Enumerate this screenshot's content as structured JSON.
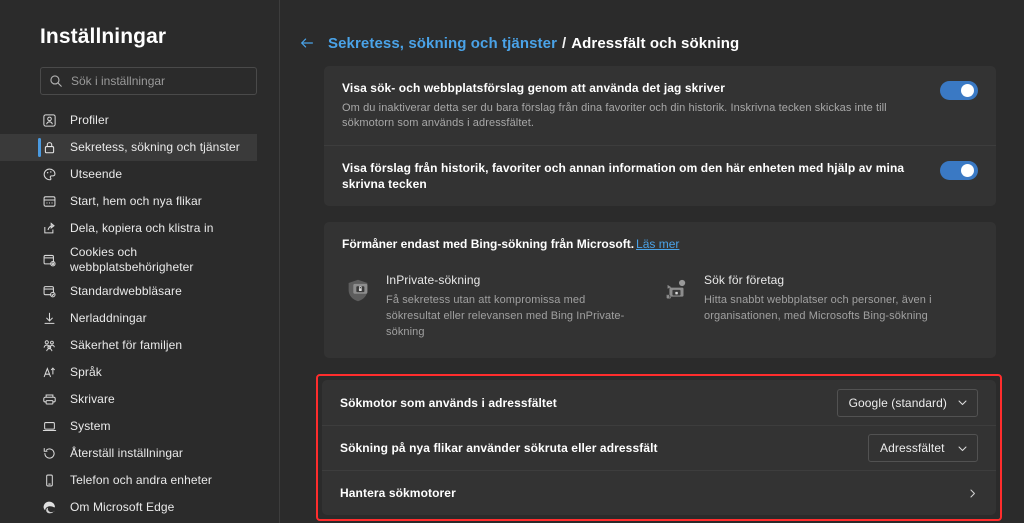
{
  "sidebar": {
    "title": "Inställningar",
    "search": {
      "placeholder": "Sök i inställningar",
      "value": "",
      "icon": "search-icon"
    },
    "items": [
      {
        "label": "Profiler",
        "icon": "profile-card-icon",
        "selected": false
      },
      {
        "label": "Sekretess, sökning och tjänster",
        "icon": "lock-icon",
        "selected": true
      },
      {
        "label": "Utseende",
        "icon": "palette-icon",
        "selected": false
      },
      {
        "label": "Start, hem och nya flikar",
        "icon": "browser-window-icon",
        "selected": false
      },
      {
        "label": "Dela, kopiera och klistra in",
        "icon": "share-icon",
        "selected": false
      },
      {
        "label": "Cookies och webbplatsbehörigheter",
        "icon": "cookie-settings-icon",
        "selected": false
      },
      {
        "label": "Standardwebbläsare",
        "icon": "default-browser-check-icon",
        "selected": false
      },
      {
        "label": "Nerladdningar",
        "icon": "download-arrow-icon",
        "selected": false
      },
      {
        "label": "Säkerhet för familjen",
        "icon": "family-people-icon",
        "selected": false
      },
      {
        "label": "Språk",
        "icon": "language-a-icon",
        "selected": false
      },
      {
        "label": "Skrivare",
        "icon": "printer-icon",
        "selected": false
      },
      {
        "label": "System",
        "icon": "laptop-icon",
        "selected": false
      },
      {
        "label": "Återställ inställningar",
        "icon": "reset-arrow-icon",
        "selected": false
      },
      {
        "label": "Telefon och andra enheter",
        "icon": "phone-icon",
        "selected": false
      },
      {
        "label": "Om Microsoft Edge",
        "icon": "edge-logo-icon",
        "selected": false
      }
    ]
  },
  "breadcrumb": {
    "back_icon": "back-arrow-icon",
    "parent": "Sekretess, sökning och tjänster",
    "separator": "/",
    "current": "Adressfält och sökning"
  },
  "suggestions_card": {
    "rows": [
      {
        "title": "Visa sök- och webbplatsförslag genom att använda det jag skriver",
        "description": "Om du inaktiverar detta ser du bara förslag från dina favoriter och din historik. Inskrivna tecken skickas inte till sökmotorn som används i adressfältet.",
        "toggle_on": true
      },
      {
        "title": "Visa förslag från historik, favoriter och annan information om den här enheten med hjälp av mina skrivna tecken",
        "description": "",
        "toggle_on": true
      }
    ]
  },
  "bing_promo": {
    "heading": "Förmåner endast med Bing-sökning från Microsoft.",
    "link": "Läs mer",
    "items": [
      {
        "icon": "inprivate-shield-lock-icon",
        "title": "InPrivate-sökning",
        "description": "Få sekretess utan att kompromissa med sökresultat eller relevansen med Bing InPrivate-sökning"
      },
      {
        "icon": "business-search-icon",
        "title": "Sök för företag",
        "description": "Hitta snabbt webbplatser och personer, även i organisationen, med Microsofts Bing-sökning"
      }
    ]
  },
  "search_engine_card": {
    "highlighted": true,
    "highlight_color": "#ff2d2d",
    "rows": [
      {
        "label": "Sökmotor som används i adressfältet",
        "control": "dropdown",
        "value": "Google (standard)",
        "icon": "chevron-down-icon"
      },
      {
        "label": "Sökning på nya flikar använder sökruta eller adressfält",
        "control": "dropdown",
        "value": "Adressfältet",
        "icon": "chevron-down-icon"
      },
      {
        "label": "Hantera sökmotorer",
        "control": "navigate",
        "value": "",
        "icon": "chevron-right-icon"
      }
    ]
  },
  "theme": {
    "background": "#2b2b2b",
    "card": "#333333",
    "accent_blue": "#4aa3e8",
    "toggle_on": "#3a79c4",
    "highlight_red": "#ff2d2d"
  }
}
